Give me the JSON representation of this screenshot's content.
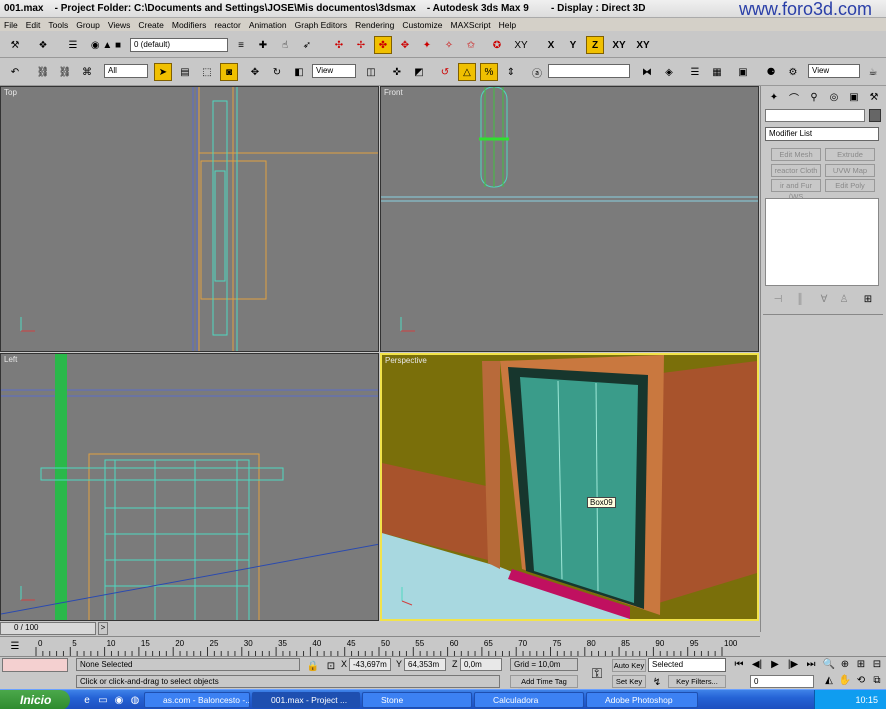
{
  "window": {
    "title": "001.max    - Project Folder: C:\\Documents and Settings\\JOSE\\Mis documentos\\3dsmax    - Autodesk 3ds Max 9        - Display : Direct 3D",
    "watermark": "www.foro3d.com"
  },
  "menu": [
    "File",
    "Edit",
    "Tools",
    "Group",
    "Views",
    "Create",
    "Modifiers",
    "reactor",
    "Animation",
    "Graph Editors",
    "Rendering",
    "Customize",
    "MAXScript",
    "Help"
  ],
  "toolbar": {
    "layer_dropdown": "0 (default)",
    "axis_labels": [
      "X",
      "Y",
      "Z",
      "XY",
      "XY"
    ],
    "selection_filter": "All",
    "ref_coord": "View",
    "named_selection": "",
    "view_dropdown": "View"
  },
  "viewports": {
    "top": "Top",
    "front": "Front",
    "left": "Left",
    "perspective": "Perspective"
  },
  "viewport_colors": {
    "background": "#7b7b7b",
    "wireframe": "#4fd8c0",
    "grid_orange": "#e0a040",
    "active_border": "#f2e34a",
    "wall": "#a8532c",
    "ceiling": "#7a6f0a",
    "floor": "#a8d8e0",
    "door": "#3a9c8a",
    "threshold": "#c01060"
  },
  "tooltip": "Box09",
  "command_panel": {
    "name_field": "",
    "modifier_list": "Modifier List",
    "modifier_buttons": [
      "Edit Mesh",
      "Extrude",
      "reactor Cloth",
      "UVW Map",
      "ir and Fur (WS",
      "Edit Poly"
    ]
  },
  "timeline": {
    "frame_label": "0 / 100",
    "ticks": [
      "0",
      "5",
      "10",
      "15",
      "20",
      "25",
      "30",
      "35",
      "40",
      "45",
      "50",
      "55",
      "60",
      "65",
      "70",
      "75",
      "80",
      "85",
      "90",
      "95",
      "100"
    ]
  },
  "status": {
    "selection": "None Selected",
    "prompt": "Click or click-and-drag to select objects",
    "x_label": "X",
    "x_value": "-43,697m",
    "y_label": "Y",
    "y_value": "64,353m",
    "z_label": "Z",
    "z_value": "0,0m",
    "grid": "Grid = 10,0m",
    "add_time_tag": "Add Time Tag",
    "auto_key": "Auto Key",
    "selected_dropdown": "Selected",
    "set_key": "Set Key",
    "key_filters": "Key Filters...",
    "frame_field": "0"
  },
  "taskbar": {
    "start": "Inicio",
    "tasks": [
      "as.com - Baloncesto -...",
      "001.max    - Project ...",
      "Stone",
      "Calculadora",
      "Adobe Photoshop"
    ],
    "clock": "10:15"
  }
}
